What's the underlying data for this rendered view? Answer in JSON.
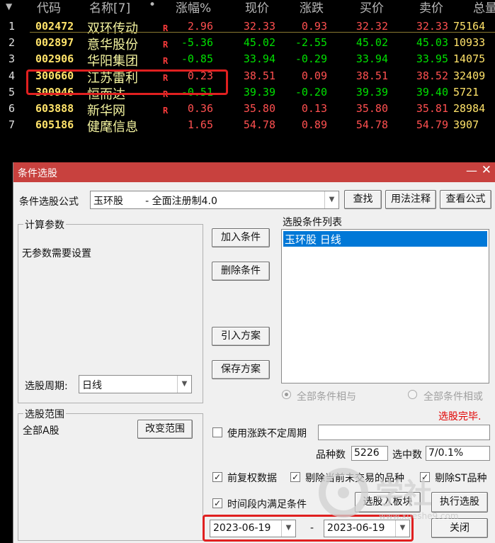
{
  "quote_header": {
    "code": "代码",
    "name": "名称[7]",
    "dot": "•",
    "change_pct": "涨幅%",
    "price": "现价",
    "change": "涨跌",
    "bid": "买价",
    "ask": "卖价",
    "volume": "总量"
  },
  "quote_rows": [
    {
      "idx": "1",
      "code": "002472",
      "name": "双环传动",
      "flag": "R",
      "chg_pct": "2.96",
      "price": "32.33",
      "chg": "0.93",
      "bid": "32.32",
      "ask": "32.33",
      "vol": "75164",
      "dir": "up"
    },
    {
      "idx": "2",
      "code": "002897",
      "name": "意华股份",
      "flag": "R",
      "chg_pct": "-5.36",
      "price": "45.02",
      "chg": "-2.55",
      "bid": "45.02",
      "ask": "45.03",
      "vol": "10933",
      "dir": "down"
    },
    {
      "idx": "3",
      "code": "002906",
      "name": "华阳集团",
      "flag": "R",
      "chg_pct": "-0.85",
      "price": "33.94",
      "chg": "-0.29",
      "bid": "33.94",
      "ask": "33.95",
      "vol": "14075",
      "dir": "down"
    },
    {
      "idx": "4",
      "code": "300660",
      "name": "江苏雷利",
      "flag": "R",
      "chg_pct": "0.23",
      "price": "38.51",
      "chg": "0.09",
      "bid": "38.51",
      "ask": "38.52",
      "vol": "32409",
      "dir": "up"
    },
    {
      "idx": "5",
      "code": "300946",
      "name": "恒而达",
      "flag": "R",
      "chg_pct": "-0.51",
      "price": "39.39",
      "chg": "-0.20",
      "bid": "39.39",
      "ask": "39.40",
      "vol": "5721",
      "dir": "down"
    },
    {
      "idx": "6",
      "code": "603888",
      "name": "新华网",
      "flag": "R",
      "chg_pct": "0.36",
      "price": "35.80",
      "chg": "0.13",
      "bid": "35.80",
      "ask": "35.81",
      "vol": "28984",
      "dir": "up"
    },
    {
      "idx": "7",
      "code": "605186",
      "name": "健麾信息",
      "flag": "",
      "chg_pct": "1.65",
      "price": "54.78",
      "chg": "0.89",
      "bid": "54.78",
      "ask": "54.79",
      "vol": "3907",
      "dir": "up"
    }
  ],
  "dialog": {
    "title": "条件选股",
    "formula_label": "条件选股公式",
    "formula_value": "玉环股       - 全面注册制4.0",
    "btn_find": "查找",
    "btn_usage": "用法注释",
    "btn_view": "查看公式",
    "params_group": "计算参数",
    "params_text": "无参数需要设置",
    "period_label": "选股周期:",
    "period_value": "日线",
    "btn_add": "加入条件",
    "btn_delete": "删除条件",
    "btn_import": "引入方案",
    "btn_save": "保存方案",
    "list_title": "选股条件列表",
    "list_items": [
      "玉环股  日线"
    ],
    "radio_and": "全部条件相与",
    "radio_or": "全部条件相或",
    "status": "选股完毕.",
    "range_group": "选股范围",
    "range_value": "全部A股",
    "btn_change_range": "改变范围",
    "chk_uncertain": "使用涨跌不定周期",
    "count_label": "品种数",
    "count_value": "5226",
    "selected_label": "选中数",
    "selected_value": "7/0.1%",
    "chk_adjust": "前复权数据",
    "chk_exclude_untraded": "剔除当前未交易的品种",
    "chk_exclude_st": "剔除ST品种",
    "chk_time_range": "时间段内满足条件",
    "btn_to_block": "选股入板块",
    "btn_execute": "执行选股",
    "date_from": "2023-06-19",
    "date_sep": "-",
    "date_to": "2023-06-19",
    "btn_close": "关闭"
  },
  "watermark": {
    "text": "学社",
    "url": "www.xueshe9.com"
  }
}
